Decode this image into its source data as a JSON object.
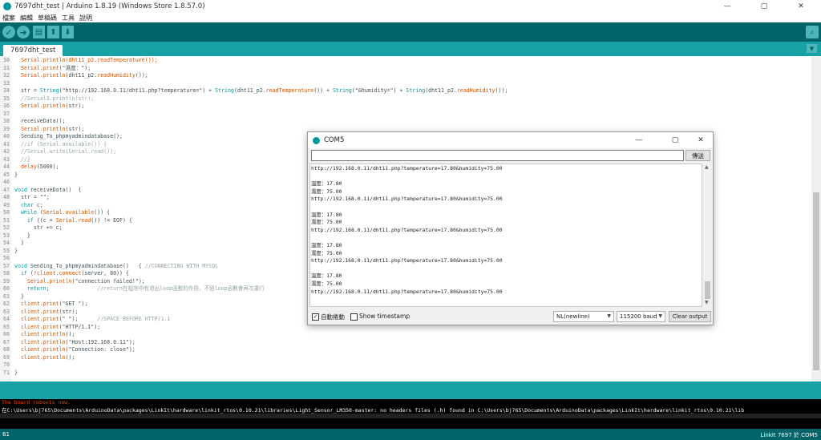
{
  "window": {
    "title": "7697dht_test | Arduino 1.8.19 (Windows Store 1.8.57.0)"
  },
  "menu": [
    "檔案",
    "編輯",
    "草稿碼",
    "工具",
    "說明"
  ],
  "tab": {
    "label": "7697dht_test"
  },
  "code": [
    {
      "n": "30",
      "parts": [
        [
          "fn",
          "  Serial.println(dht11_p2.readTemperature());"
        ]
      ]
    },
    {
      "n": "31",
      "parts": [
        [
          "fn",
          "  Serial.print"
        ],
        [
          "txt",
          "(\"濕度：\");"
        ]
      ]
    },
    {
      "n": "32",
      "parts": [
        [
          "fn",
          "  Serial.println"
        ],
        [
          "txt",
          "(dht11_p2."
        ],
        [
          "fn",
          "readHumidity"
        ],
        [
          "txt",
          "());"
        ]
      ]
    },
    {
      "n": "33",
      "parts": [
        [
          "txt",
          ""
        ]
      ]
    },
    {
      "n": "34",
      "parts": [
        [
          "txt",
          "  str = "
        ],
        [
          "type",
          "String"
        ],
        [
          "txt",
          "(\"http://192.168.0.11/dht11.php?temperature=\") + "
        ],
        [
          "type",
          "String"
        ],
        [
          "txt",
          "(dht11_p2."
        ],
        [
          "fn",
          "readTemperature"
        ],
        [
          "txt",
          "()) + "
        ],
        [
          "type",
          "String"
        ],
        [
          "txt",
          "(\"&humidity=\") + "
        ],
        [
          "type",
          "String"
        ],
        [
          "txt",
          "(dht11_p2."
        ],
        [
          "fn",
          "readHumidity"
        ],
        [
          "txt",
          "());"
        ]
      ]
    },
    {
      "n": "35",
      "parts": [
        [
          "cmt",
          "  //Serial3.println(str);"
        ]
      ]
    },
    {
      "n": "36",
      "parts": [
        [
          "fn",
          "  Serial.println"
        ],
        [
          "txt",
          "(str);"
        ]
      ]
    },
    {
      "n": "37",
      "parts": [
        [
          "txt",
          ""
        ]
      ]
    },
    {
      "n": "38",
      "parts": [
        [
          "txt",
          "  receiveData();"
        ]
      ]
    },
    {
      "n": "39",
      "parts": [
        [
          "fn",
          "  Serial.println"
        ],
        [
          "txt",
          "(str);"
        ]
      ]
    },
    {
      "n": "40",
      "parts": [
        [
          "txt",
          "  Sending_To_phpmyadmindatabase();"
        ]
      ]
    },
    {
      "n": "41",
      "parts": [
        [
          "cmt",
          "  //if (Serial.available()) {"
        ]
      ]
    },
    {
      "n": "42",
      "parts": [
        [
          "cmt",
          "  //Serial.write(Serial.read());"
        ]
      ]
    },
    {
      "n": "43",
      "parts": [
        [
          "cmt",
          "  //}"
        ]
      ]
    },
    {
      "n": "44",
      "parts": [
        [
          "fn",
          "  delay"
        ],
        [
          "txt",
          "(5000);"
        ]
      ]
    },
    {
      "n": "45",
      "parts": [
        [
          "txt",
          "}"
        ]
      ]
    },
    {
      "n": "46",
      "parts": [
        [
          "txt",
          ""
        ]
      ]
    },
    {
      "n": "47",
      "parts": [
        [
          "type",
          "void"
        ],
        [
          "txt",
          " receiveData()  {"
        ]
      ]
    },
    {
      "n": "48",
      "parts": [
        [
          "txt",
          "  str = \"\";"
        ]
      ]
    },
    {
      "n": "49",
      "parts": [
        [
          "type",
          "  char"
        ],
        [
          "txt",
          " c;"
        ]
      ]
    },
    {
      "n": "50",
      "parts": [
        [
          "type",
          "  while"
        ],
        [
          "txt",
          " ("
        ],
        [
          "fn",
          "Serial.available"
        ],
        [
          "txt",
          "()) {"
        ]
      ]
    },
    {
      "n": "51",
      "parts": [
        [
          "type",
          "    if"
        ],
        [
          "txt",
          " ((c = "
        ],
        [
          "fn",
          "Serial.read"
        ],
        [
          "txt",
          "()) != EOF) {"
        ]
      ]
    },
    {
      "n": "52",
      "parts": [
        [
          "txt",
          "      str += c;"
        ]
      ]
    },
    {
      "n": "53",
      "parts": [
        [
          "txt",
          "    }"
        ]
      ]
    },
    {
      "n": "54",
      "parts": [
        [
          "txt",
          "  }"
        ]
      ]
    },
    {
      "n": "55",
      "parts": [
        [
          "txt",
          "}"
        ]
      ]
    },
    {
      "n": "56",
      "parts": [
        [
          "txt",
          ""
        ]
      ]
    },
    {
      "n": "57",
      "parts": [
        [
          "type",
          "void"
        ],
        [
          "txt",
          " Sending_To_phpmyadmindatabase()   { "
        ],
        [
          "cmt",
          "//CONNECTING WITH MYSQL"
        ]
      ]
    },
    {
      "n": "58",
      "parts": [
        [
          "type",
          "  if"
        ],
        [
          "txt",
          " (!"
        ],
        [
          "fn",
          "client.connect"
        ],
        [
          "txt",
          "(server, 80)) {"
        ]
      ]
    },
    {
      "n": "59",
      "parts": [
        [
          "fn",
          "    Serial.println"
        ],
        [
          "txt",
          "(\"connection failed!\");"
        ]
      ]
    },
    {
      "n": "60",
      "parts": [
        [
          "type",
          "    return"
        ],
        [
          "txt",
          ";               "
        ],
        [
          "cmt",
          "//return在程序中有退出loop函數的作用，不過loop函數會再次運行"
        ]
      ]
    },
    {
      "n": "61",
      "parts": [
        [
          "txt",
          "  }"
        ]
      ]
    },
    {
      "n": "62",
      "parts": [
        [
          "fn",
          "  client.print"
        ],
        [
          "txt",
          "(\"GET \");"
        ]
      ]
    },
    {
      "n": "63",
      "parts": [
        [
          "fn",
          "  client.print"
        ],
        [
          "txt",
          "(str);"
        ]
      ]
    },
    {
      "n": "64",
      "parts": [
        [
          "fn",
          "  client.print"
        ],
        [
          "txt",
          "(\" \");      "
        ],
        [
          "cmt",
          "//SPACE BEFORE HTTP/1.1"
        ]
      ]
    },
    {
      "n": "65",
      "parts": [
        [
          "fn",
          "  client.print"
        ],
        [
          "txt",
          "(\"HTTP/1.1\");"
        ]
      ]
    },
    {
      "n": "66",
      "parts": [
        [
          "fn",
          "  client.println"
        ],
        [
          "txt",
          "();"
        ]
      ]
    },
    {
      "n": "67",
      "parts": [
        [
          "fn",
          "  client.println"
        ],
        [
          "txt",
          "(\"Host:192.168.0.11\");"
        ]
      ]
    },
    {
      "n": "68",
      "parts": [
        [
          "fn",
          "  client.println"
        ],
        [
          "txt",
          "(\"Connection: close\");"
        ]
      ]
    },
    {
      "n": "69",
      "parts": [
        [
          "fn",
          "  client.println"
        ],
        [
          "txt",
          "();"
        ]
      ]
    },
    {
      "n": "70",
      "parts": [
        [
          "txt",
          ""
        ]
      ]
    },
    {
      "n": "71",
      "parts": [
        [
          "txt",
          "}"
        ]
      ]
    }
  ],
  "serial": {
    "title": "COM5",
    "send_label": "傳送",
    "input_value": "",
    "output": [
      "http://192.168.0.11/dht11.php?temperature=17.80&humidity=75.00",
      "",
      "溫度：17.80",
      "濕度：75.00",
      "http://192.168.0.11/dht11.php?temperature=17.80&humidity=75.00",
      "",
      "溫度：17.80",
      "濕度：75.00",
      "http://192.168.0.11/dht11.php?temperature=17.80&humidity=75.00",
      "",
      "溫度：17.80",
      "濕度：75.00",
      "http://192.168.0.11/dht11.php?temperature=17.80&humidity=75.00",
      "",
      "溫度：17.80",
      "濕度：75.00",
      "http://192.168.0.11/dht11.php?temperature=17.80&humidity=75.00"
    ],
    "autoscroll_label": "自動捲動",
    "autoscroll_checked": true,
    "timestamp_label": "Show timestamp",
    "timestamp_checked": false,
    "line_ending": "NL(newline)",
    "baud": "115200 baud",
    "clear_label": "Clear output"
  },
  "console": {
    "line1": "The board reboots now.",
    "line2": "在C:\\Users\\bj765\\Documents\\ArduinoData\\packages\\LinkIt\\hardware\\linkit_rtos\\0.10.21\\libraries\\Light_Sensor_LM350-master: no headers files (.h) found in C:\\Users\\bj765\\Documents\\ArduinoData\\packages\\LinkIt\\hardware\\linkit_rtos\\0.10.21\\lib"
  },
  "status": {
    "line": "61",
    "board": "LinkIt 7697 於 COM5"
  },
  "icons": {
    "verify": "check-icon",
    "upload": "arrow-right-icon",
    "new": "new-file-icon",
    "open": "open-arrow-up-icon",
    "save": "save-arrow-down-icon",
    "serial_monitor": "magnifier-icon"
  },
  "colors": {
    "toolbar": "#006468",
    "tabbar": "#17a1a5",
    "button": "#4db7bb",
    "console_error": "#e34c00"
  }
}
